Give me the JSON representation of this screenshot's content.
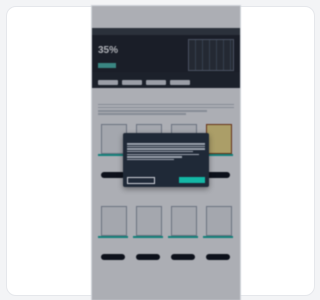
{
  "colors": {
    "brand_dark": "#1f2328",
    "accent_teal": "#14b8a6",
    "price_red": "#be123c",
    "overlay": "rgba(17,24,39,0.35)"
  },
  "page": {
    "hero_percent": "35%"
  }
}
